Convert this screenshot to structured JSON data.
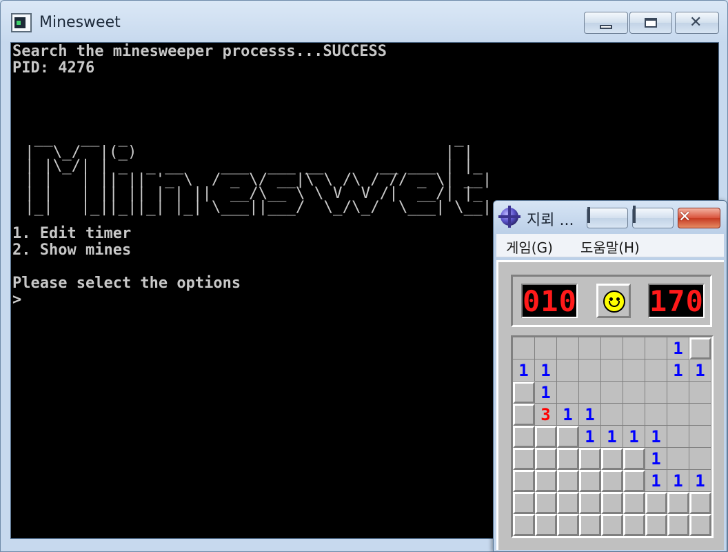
{
  "console": {
    "title": "Minesweet",
    "lines": [
      "Search the minesweeper processs...SUCCESS",
      "PID: 4276",
      "",
      "",
      "",
      "",
      "",
      "",
      "",
      "",
      "",
      "1. Edit timer",
      "2. Show mines",
      "",
      "Please select the options",
      ">"
    ],
    "ascii_art": " __   __  _                                   _\n|  \\_/  |(_)                                 | |\n| |\\_/| | _  _ __    ___  ___ __      __ ___ | |_\n| |   | || || '_ \\  / _ \\/ __|\\ \\ /\\ / // _ \\| __|\n| |   | || || | | ||  __/\\__ \\ \\ V  V /|  __/| |_\n|_|   |_||_||_| |_| \\___||___/  \\_/\\_/  \\___| \\__|"
  },
  "minesweeper": {
    "title": "지뢰 ...",
    "menu": {
      "game": "게임(G)",
      "help": "도움말(H)"
    },
    "mines_counter": "010",
    "timer": "170",
    "grid": [
      [
        " ",
        " ",
        " ",
        " ",
        " ",
        " ",
        " ",
        "1",
        "#"
      ],
      [
        "1",
        "1",
        " ",
        " ",
        " ",
        " ",
        " ",
        "1",
        "1"
      ],
      [
        "#",
        "1",
        " ",
        " ",
        " ",
        " ",
        " ",
        " ",
        " "
      ],
      [
        "#",
        "3",
        "1",
        "1",
        " ",
        " ",
        " ",
        " ",
        " "
      ],
      [
        "#",
        "#",
        "#",
        "1",
        "1",
        "1",
        "1",
        " ",
        " "
      ],
      [
        "#",
        "#",
        "#",
        "#",
        "#",
        "#",
        "1",
        " ",
        " "
      ],
      [
        "#",
        "#",
        "#",
        "#",
        "#",
        "#",
        "1",
        "1",
        "1"
      ],
      [
        "#",
        "#",
        "#",
        "#",
        "#",
        "#",
        "#",
        "#",
        "#"
      ],
      [
        "#",
        "#",
        "#",
        "#",
        "#",
        "#",
        "#",
        "#",
        "#"
      ]
    ]
  }
}
